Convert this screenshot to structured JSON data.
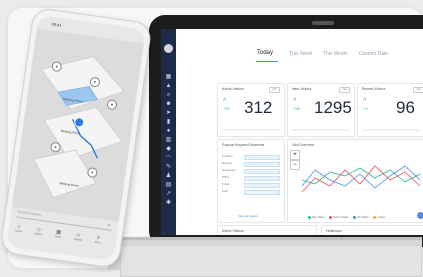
{
  "phone": {
    "time": "09:41",
    "search_placeholder": "Search location",
    "close_glyph": "×",
    "pin_labels": [
      "Meeting Room",
      "Meeting Room",
      "Meeting Room"
    ],
    "nav": [
      {
        "icon": "home-icon",
        "glyph": "⌂",
        "label": "Home"
      },
      {
        "icon": "map-icon",
        "glyph": "◇",
        "label": "Explore"
      },
      {
        "icon": "calendar-icon",
        "glyph": "▦",
        "label": "Book"
      },
      {
        "icon": "people-icon",
        "glyph": "☺",
        "label": "People"
      },
      {
        "icon": "more-icon",
        "glyph": "≡",
        "label": "More"
      }
    ]
  },
  "dashboard": {
    "tabs": [
      "Today",
      "This Week",
      "This Month",
      "Custom Date"
    ],
    "stats": [
      {
        "label": "Active Visitors",
        "pill": "info",
        "change": "+32",
        "value": "312"
      },
      {
        "label": "New Visitors",
        "pill": "info",
        "change": "+58",
        "value": "1295"
      },
      {
        "label": "Recent Visitors",
        "pill": "info",
        "change": "+3",
        "value": "96"
      }
    ],
    "keywords": {
      "title": "Popular Keyword Searches",
      "rows": [
        "Location",
        "Meeting",
        "Restaurant",
        "Office",
        "Toilets",
        "Cafe"
      ],
      "view_all": "View all results"
    },
    "visit_overview": {
      "title": "Visit Overview",
      "legend": [
        {
          "label": "New Visitor",
          "color": "#2bb5a0"
        },
        {
          "label": "Return Visitor",
          "color": "#e8505b"
        },
        {
          "label": "All Visitors",
          "color": "#4a90e2"
        },
        {
          "label": "Unique",
          "color": "#f0b429"
        }
      ]
    },
    "active_visitors_panel": {
      "title": "Active Visitors"
    },
    "heatmaps_panel": {
      "title": "Heatmaps"
    }
  },
  "colors": {
    "sidebar": "#1b2b48",
    "accent": "#4a90e2",
    "positive": "#2bb5a0"
  }
}
